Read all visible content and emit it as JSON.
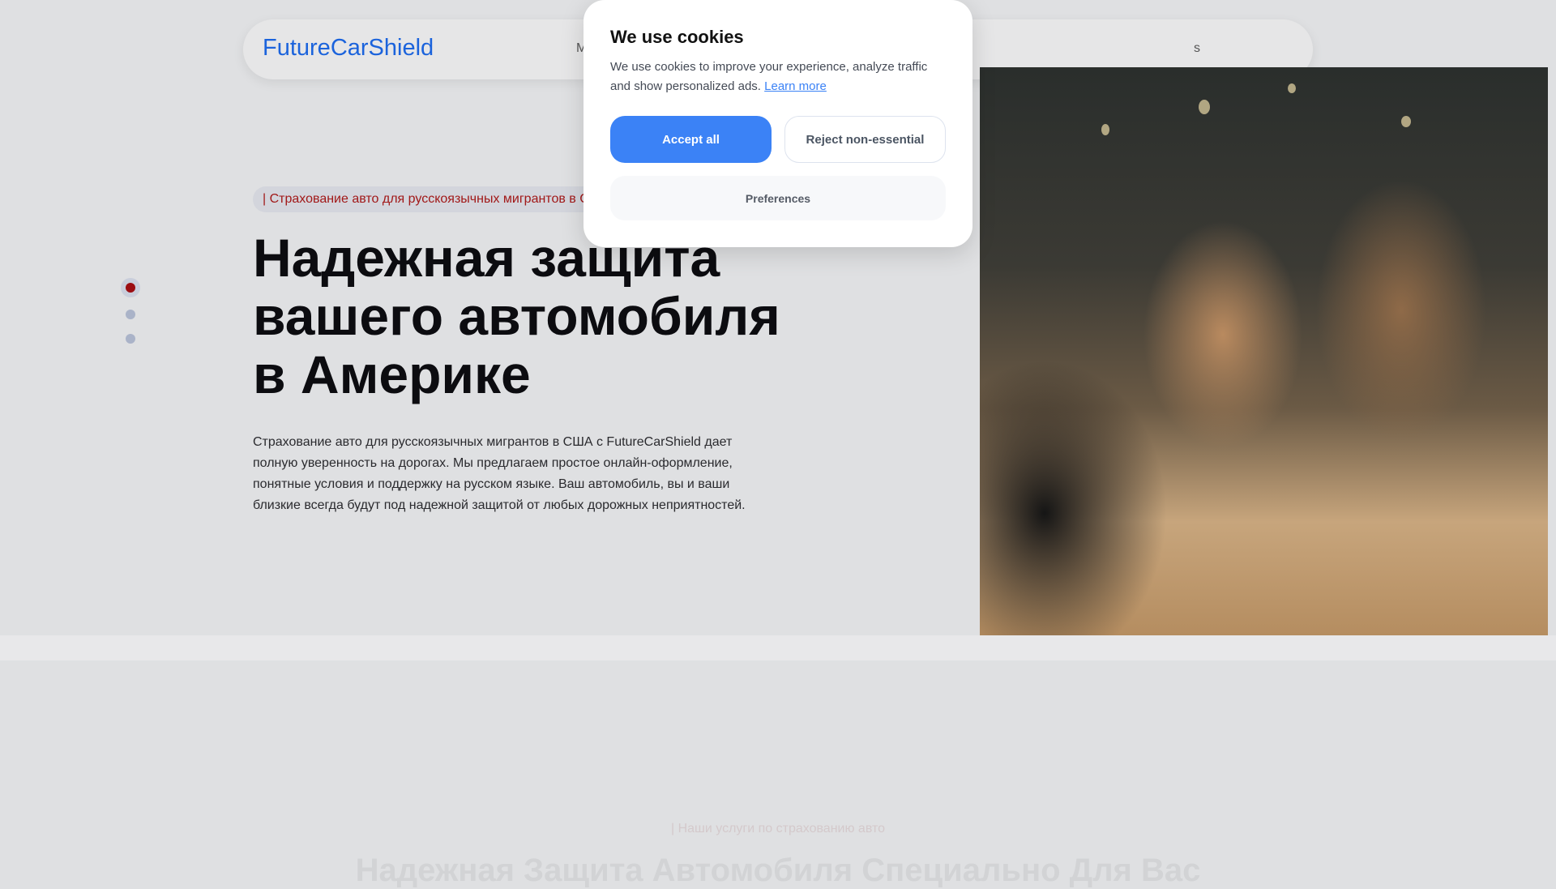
{
  "header": {
    "logo": "FutureCarShield",
    "nav_left_partial": "M",
    "nav_right_partial": "s"
  },
  "hero": {
    "tag": "| Страхование авто для русскоязычных мигрантов в США",
    "title": "Надежная защита вашего автомобиля в Америке",
    "description": "Страхование авто для русскоязычных мигрантов в США с FutureCarShield дает полную уверенность на дорогах. Мы предлагаем простое онлайн-оформление, понятные условия и поддержку на русском языке. Ваш автомобиль, вы и ваши близкие всегда будут под надежной защитой от любых дорожных неприятностей.",
    "slides": 3,
    "active_slide": 1
  },
  "services": {
    "tag": "| Наши услуги по страхованию авто",
    "title": "Надежная Защита Автомобиля Специально Для Вас"
  },
  "cookie": {
    "title": "We use cookies",
    "text": "We use cookies to improve your experience, analyze traffic and show personalized ads.",
    "learn_more": "Learn more",
    "accept": "Accept all",
    "reject": "Reject non-essential",
    "preferences": "Preferences"
  },
  "colors": {
    "brand": "#1b63dc",
    "accent": "#3b82f6",
    "tag_red": "#a11818"
  }
}
